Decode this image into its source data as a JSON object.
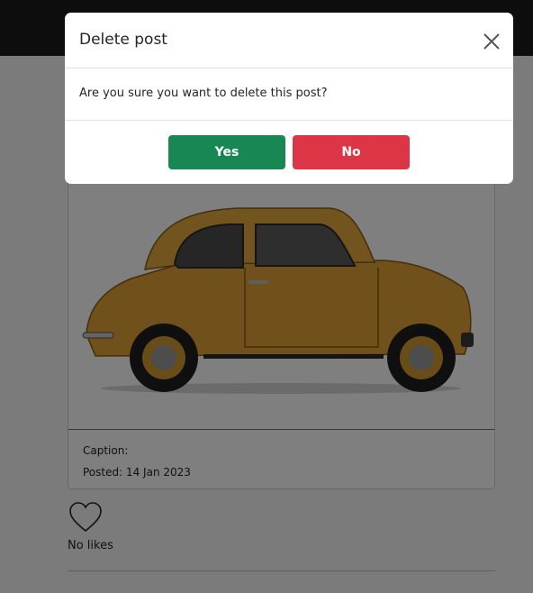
{
  "post": {
    "caption_label": "Caption:",
    "posted_label": "Posted: 14 Jan 2023",
    "likes_label": "No likes"
  },
  "modal": {
    "title": "Delete post",
    "message": "Are you sure you want to delete this post?",
    "yes_label": "Yes",
    "no_label": "No"
  },
  "icons": {
    "close": "close-icon",
    "like": "heart-icon"
  },
  "colors": {
    "yes_button": "#198754",
    "no_button": "#dc3545",
    "car_body": "#e0a236"
  }
}
